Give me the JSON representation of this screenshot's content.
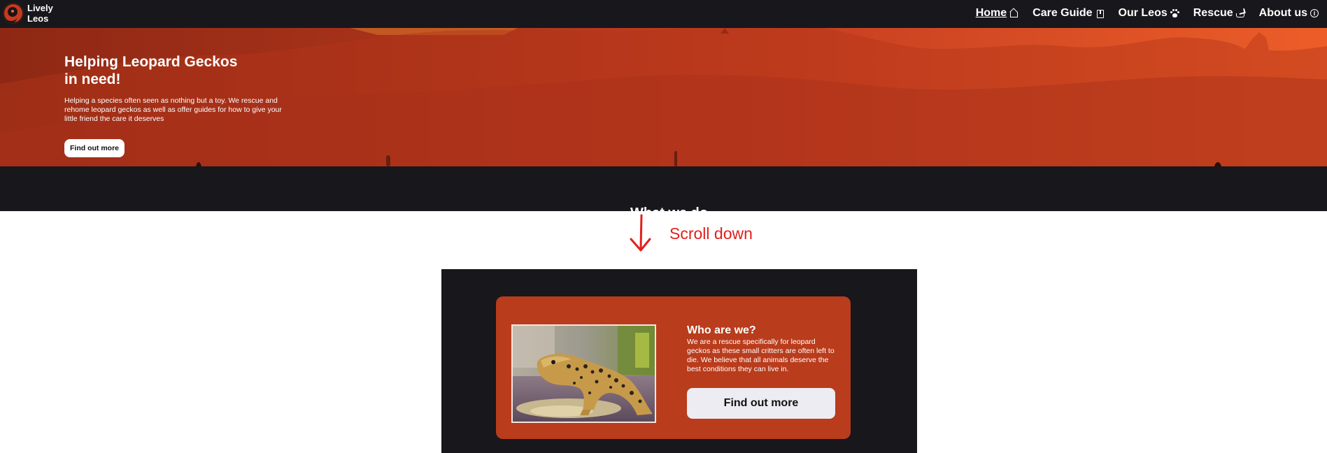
{
  "nav": {
    "brand_line1": "Lively",
    "brand_line2": "Leos",
    "links": [
      {
        "label": "Home",
        "icon": "home-icon",
        "active": true
      },
      {
        "label": "Care Guide",
        "icon": "book-icon"
      },
      {
        "label": "Our Leos",
        "icon": "paw-icon"
      },
      {
        "label": "Rescue",
        "icon": "rescue-icon"
      },
      {
        "label": "About us",
        "icon": "info-icon"
      }
    ]
  },
  "hero": {
    "title": "Helping Leopard Geckos in need!",
    "text": "Helping a species often seen as nothing but a toy. We rescue and rehome leopard geckos as well as offer guides for how to give your little friend the care it deserves",
    "button": "Find out more"
  },
  "section": {
    "heading": "What we do"
  },
  "annotation": {
    "label": "Scroll down"
  },
  "card": {
    "heading": "Who are we?",
    "text": "We are a rescue specifically for leopard geckos as these small critters are often left to die. We believe that all animals deserve the best conditions they can live in.",
    "button": "Find out more"
  },
  "colors": {
    "nav_bg": "#18171c",
    "hero_dark": "#8e2814",
    "hero_light": "#ec5d28",
    "card_bg": "#b93c1c",
    "annotation": "#e0201c"
  }
}
